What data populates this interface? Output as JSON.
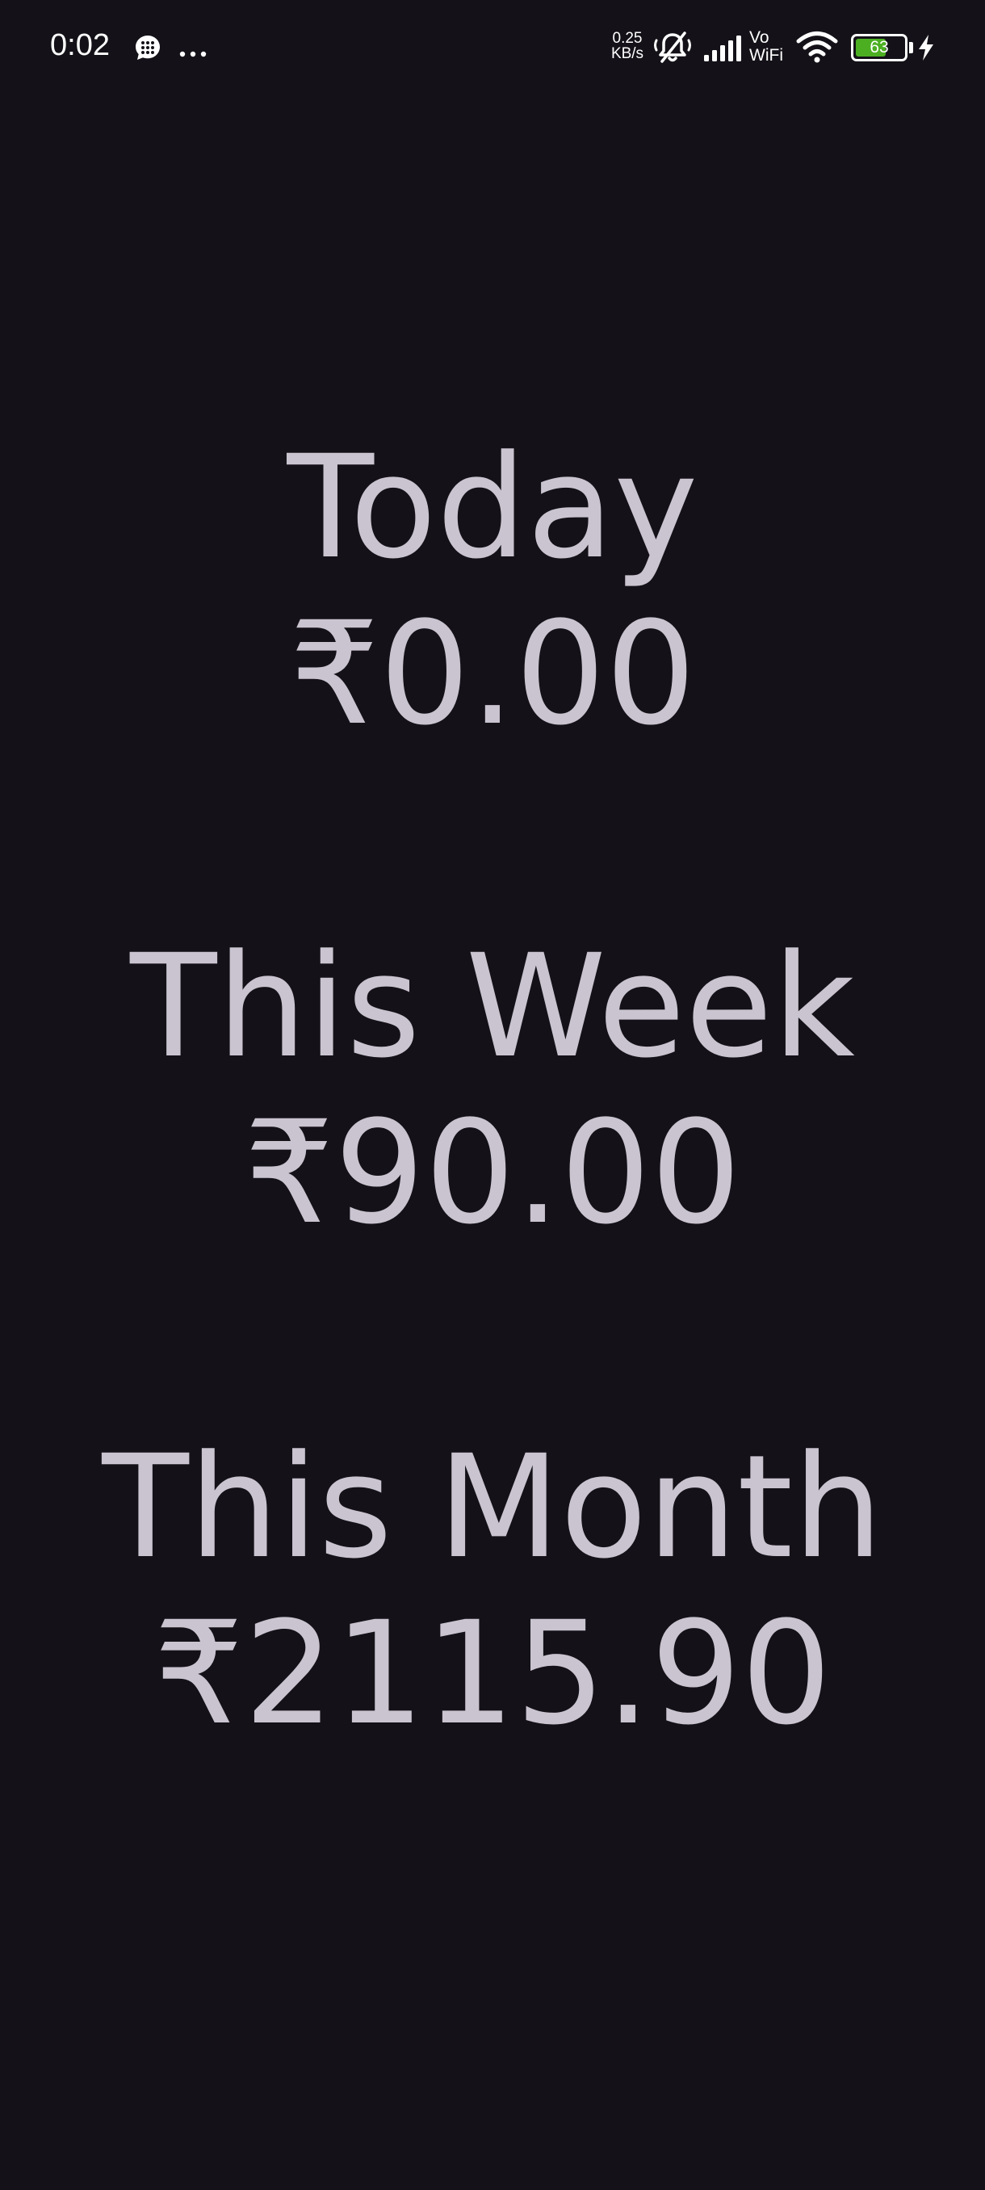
{
  "status_bar": {
    "time": "0:02",
    "net_speed_value": "0.25",
    "net_speed_unit": "KB/s",
    "vowifi_line1": "Vo",
    "vowifi_line2": "WiFi",
    "battery_level": "63",
    "battery_fraction": 0.63,
    "battery_color": "#4caf22",
    "icons": [
      "message-icon",
      "more-icon",
      "mute-icon",
      "signal-icon",
      "wifi-icon",
      "charging-icon"
    ]
  },
  "stats": {
    "today": {
      "label": "Today",
      "value": "₹0.00"
    },
    "week": {
      "label": "This Week",
      "value": "₹90.00"
    },
    "month": {
      "label": "This Month",
      "value": "₹2115.90"
    }
  },
  "colors": {
    "background": "#141218",
    "text": "#CAC4D0"
  }
}
